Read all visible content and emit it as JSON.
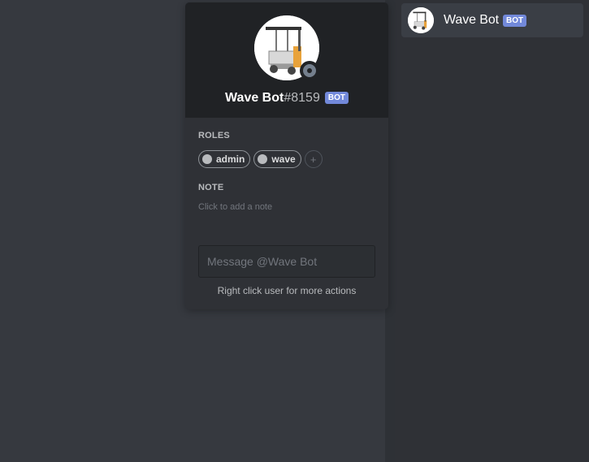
{
  "user": {
    "username": "Wave Bot",
    "discriminator": "#8159",
    "bot_tag": "BOT",
    "status": "offline"
  },
  "popout": {
    "roles_title": "ROLES",
    "roles": [
      {
        "label": "admin",
        "color": "#b9bbbe"
      },
      {
        "label": "wave",
        "color": "#b9bbbe"
      }
    ],
    "add_role_icon": "plus-icon",
    "note_title": "NOTE",
    "note_placeholder": "Click to add a note",
    "message_placeholder": "Message @Wave Bot",
    "hint": "Right click user for more actions"
  },
  "member_list": {
    "members": [
      {
        "name": "Wave Bot",
        "bot_tag": "BOT"
      }
    ]
  },
  "colors": {
    "blurple": "#7289da",
    "background": "#36393f",
    "sidebar": "#2f3136",
    "header": "#202225"
  }
}
